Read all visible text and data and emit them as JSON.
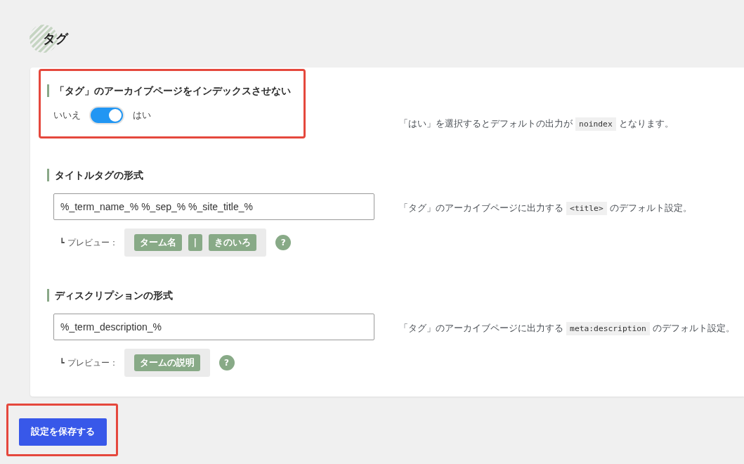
{
  "heading": "タグ",
  "settings": [
    {
      "kind": "toggle",
      "highlighted": true,
      "label": "「タグ」のアーカイブページをインデックスさせない",
      "off_label": "いいえ",
      "on_label": "はい",
      "on": true,
      "note": [
        {
          "kind": "text",
          "text": "「はい」を選択するとデフォルトの出力が "
        },
        {
          "kind": "code",
          "text": "noindex"
        },
        {
          "kind": "text",
          "text": " となります。"
        }
      ]
    },
    {
      "kind": "text",
      "highlighted": false,
      "label": "タイトルタグの形式",
      "value": "%_term_name_% %_sep_% %_site_title_%",
      "preview": {
        "label": "┗ プレビュー：",
        "chips": [
          "ターム名",
          "|",
          "きのいろ"
        ],
        "help": "?"
      },
      "note": [
        {
          "kind": "text",
          "text": "「タグ」のアーカイブページに出力する "
        },
        {
          "kind": "code",
          "text": "<title>"
        },
        {
          "kind": "text",
          "text": " のデフォルト設定。"
        }
      ]
    },
    {
      "kind": "text",
      "highlighted": false,
      "label": "ディスクリプションの形式",
      "value": "%_term_description_%",
      "preview": {
        "label": "┗ プレビュー：",
        "chips": [
          "タームの説明"
        ],
        "help": "?"
      },
      "note": [
        {
          "kind": "text",
          "text": "「タグ」のアーカイブページに出力する "
        },
        {
          "kind": "code",
          "text": "meta:description"
        },
        {
          "kind": "text",
          "text": " のデフォルト設定。"
        }
      ]
    }
  ],
  "save_button": {
    "label": "設定を保存する",
    "highlighted": true
  }
}
